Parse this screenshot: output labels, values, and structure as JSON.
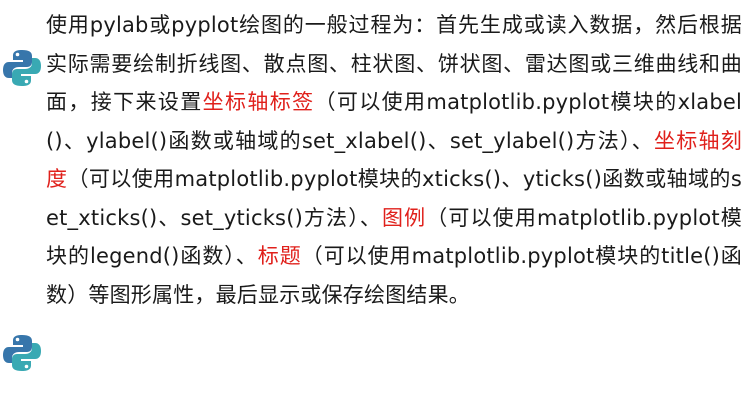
{
  "paragraph": {
    "s1": "使用pylab或pyplot绘图的一般过程为：首先生成或读入数据，然后根据实际需要绘制折线图、散点图、柱状图、饼状图、雷达图或三维曲线和曲面，接下来设置",
    "hl1": "坐标轴标签",
    "s2": "（可以使用matplotlib.pyplot模块的xlabel()、ylabel()函数或轴域的set_xlabel()、set_ylabel()方法）、",
    "hl2": "坐标轴刻度",
    "s3": "（可以使用matplotlib.pyplot模块的xticks()、yticks()函数或轴域的set_xticks()、set_yticks()方法）、",
    "hl3": "图例",
    "s4": "（可以使用matplotlib.pyplot模块的legend()函数）、",
    "hl4": "标题",
    "s5": "（可以使用matplotlib.pyplot模块的title()函数）等图形属性，最后显示或保存绘图结果。"
  },
  "colors": {
    "text": "#1a1a1a",
    "highlight": "#e0201b",
    "logo_blue": "#3776ab",
    "logo_teal": "#39a9b3"
  },
  "icons": [
    "python-logo-icon",
    "python-logo-icon"
  ]
}
